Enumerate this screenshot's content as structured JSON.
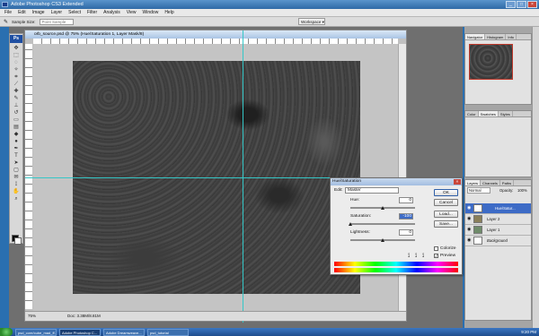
{
  "app": {
    "title": "Adobe Photoshop CS3 Extended"
  },
  "menu": [
    "File",
    "Edit",
    "Image",
    "Layer",
    "Select",
    "Filter",
    "Analysis",
    "View",
    "Window",
    "Help"
  ],
  "options_bar": {
    "sample_size_label": "Sample Size:",
    "sample_size_value": "Point Sample",
    "workspace_label": "Workspace ▾"
  },
  "document": {
    "title": "orb_source.psd @ 75% (Hue/Saturation 1, Layer Mask/8)",
    "zoom": "75%",
    "doc_info": "Doc: 3.38M/8.81M"
  },
  "dialog": {
    "title": "Hue/Saturation",
    "edit_label": "Edit:",
    "edit_value": "Master",
    "hue_label": "Hue:",
    "hue_value": "0",
    "saturation_label": "Saturation:",
    "saturation_value": "-100",
    "lightness_label": "Lightness:",
    "lightness_value": "0",
    "buttons": {
      "ok": "OK",
      "cancel": "Cancel",
      "load": "Load...",
      "save": "Save..."
    },
    "colorize_label": "Colorize",
    "preview_label": "Preview",
    "colorize_checked": false,
    "preview_checked": true,
    "hue_pos": 0.5,
    "saturation_pos": 0.0,
    "lightness_pos": 0.5
  },
  "navigator": {
    "tabs": [
      "Navigator",
      "Histogram",
      "Info"
    ]
  },
  "color_panel": {
    "tabs": [
      "Color",
      "Swatches",
      "Styles"
    ]
  },
  "layers": {
    "tabs": [
      "Layers",
      "Channels",
      "Paths"
    ],
    "blend_mode": "Normal",
    "opacity_label": "Opacity:",
    "opacity_value": "100%",
    "rows": [
      {
        "name": "Hue/Satur...",
        "selected": true
      },
      {
        "name": "Layer 2",
        "selected": false
      },
      {
        "name": "Layer 1",
        "selected": false
      },
      {
        "name": "Background",
        "selected": false
      }
    ]
  },
  "taskbar": {
    "items": [
      "psd_core/cube_mad_ff...",
      "Adobe Photoshop C...",
      "Adobe Dreamweave...",
      "psd_tutorial"
    ],
    "active_index": 1,
    "clock": "9:20 PM"
  }
}
